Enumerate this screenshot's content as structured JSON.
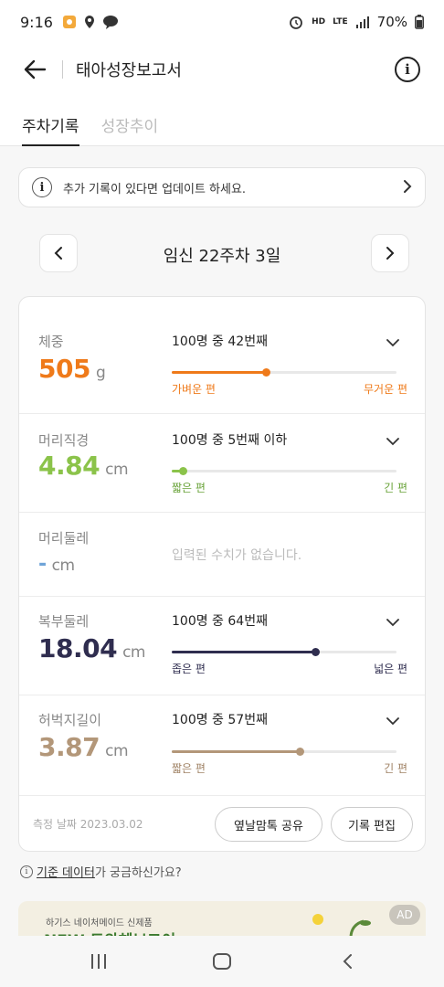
{
  "status_bar": {
    "time": "9:16",
    "network_tag": "HD",
    "network_tag2": "LTE",
    "battery": "70%"
  },
  "header": {
    "title": "태아성장보고서",
    "back_icon": "back-arrow-icon",
    "info_icon": "info-icon"
  },
  "tabs": [
    {
      "label": "주차기록",
      "active": true
    },
    {
      "label": "성장추이",
      "active": false
    }
  ],
  "notice": {
    "text": "추가 기록이 있다면 업데이트 하세요."
  },
  "week_nav": {
    "label": "임신 22주차 3일"
  },
  "metrics": [
    {
      "label": "체중",
      "value": "505",
      "unit": "g",
      "color": "#ef7a1a",
      "rank": "100명 중 42번째",
      "position_fraction": 0.42,
      "left_label": "가벼운 편",
      "right_label": "무거운 편",
      "label_color": "#ef7a1a"
    },
    {
      "label": "머리직경",
      "value": "4.84",
      "unit": "cm",
      "color": "#8bc34a",
      "rank": "100명 중 5번째 이하",
      "position_fraction": 0.05,
      "left_label": "짧은 편",
      "right_label": "긴 편",
      "label_color": "#6aa33a"
    },
    {
      "label": "머리둘레",
      "value": "-",
      "unit": "cm",
      "color": "#6fa4d8",
      "empty_text": "입력된 수치가 없습니다."
    },
    {
      "label": "복부둘레",
      "value": "18.04",
      "unit": "cm",
      "color": "#2f2d4f",
      "rank": "100명 중 64번째",
      "position_fraction": 0.64,
      "left_label": "좁은 편",
      "right_label": "넓은 편",
      "label_color": "#2f2d4f"
    },
    {
      "label": "허벅지길이",
      "value": "3.87",
      "unit": "cm",
      "color": "#b39779",
      "rank": "100명 중 57번째",
      "position_fraction": 0.57,
      "left_label": "짧은 편",
      "right_label": "긴 편",
      "label_color": "#a08366"
    }
  ],
  "footer": {
    "measure_date": "측정 날짜 2023.03.02",
    "share_button": "옆날맘톡 공유",
    "edit_button": "기록 편집"
  },
  "help": {
    "link_text": "기준 데이터",
    "suffix_text": "가 궁금하신가요?"
  },
  "ad": {
    "sub": "하기스 네이처메이드 신제품",
    "title": "NEW 도와헤브그이",
    "badge": "AD"
  }
}
